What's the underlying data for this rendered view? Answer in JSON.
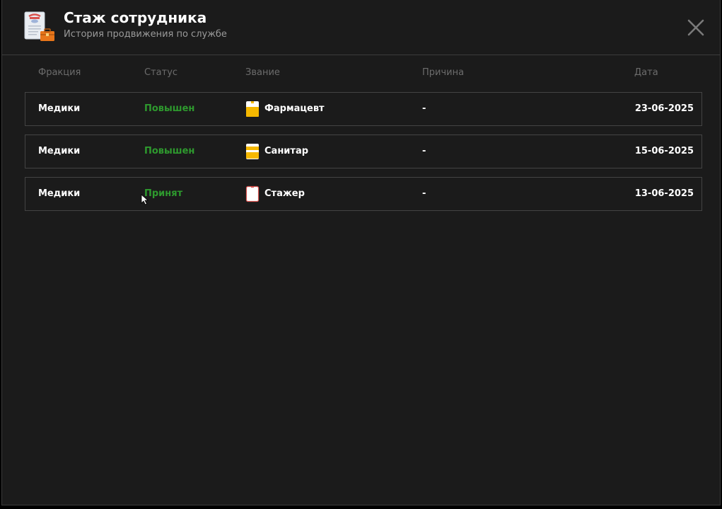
{
  "header": {
    "title": "Стаж сотрудника",
    "subtitle": "История продвижения по службе",
    "app_icon": "document-briefcase-icon",
    "close_icon": "close-icon"
  },
  "columns": {
    "faction": "Фракция",
    "status": "Статус",
    "rank": "Звание",
    "reason": "Причина",
    "date": "Дата"
  },
  "rows": [
    {
      "faction": "Медики",
      "status": "Повышен",
      "rank": "Фармацевт",
      "rank_icon": "rank-badge-icon",
      "reason": "-",
      "date": "23-06-2025"
    },
    {
      "faction": "Медики",
      "status": "Повышен",
      "rank": "Санитар",
      "rank_icon": "rank-badge-icon",
      "reason": "-",
      "date": "15-06-2025"
    },
    {
      "faction": "Медики",
      "status": "Принят",
      "rank": "Стажер",
      "rank_icon": "rank-badge-icon",
      "reason": "-",
      "date": "13-06-2025"
    }
  ],
  "colors": {
    "background": "#1b1b1b",
    "status_green": "#2e9a2e",
    "badge_yellow": "#f5b800",
    "badge_red": "#d9534f"
  }
}
